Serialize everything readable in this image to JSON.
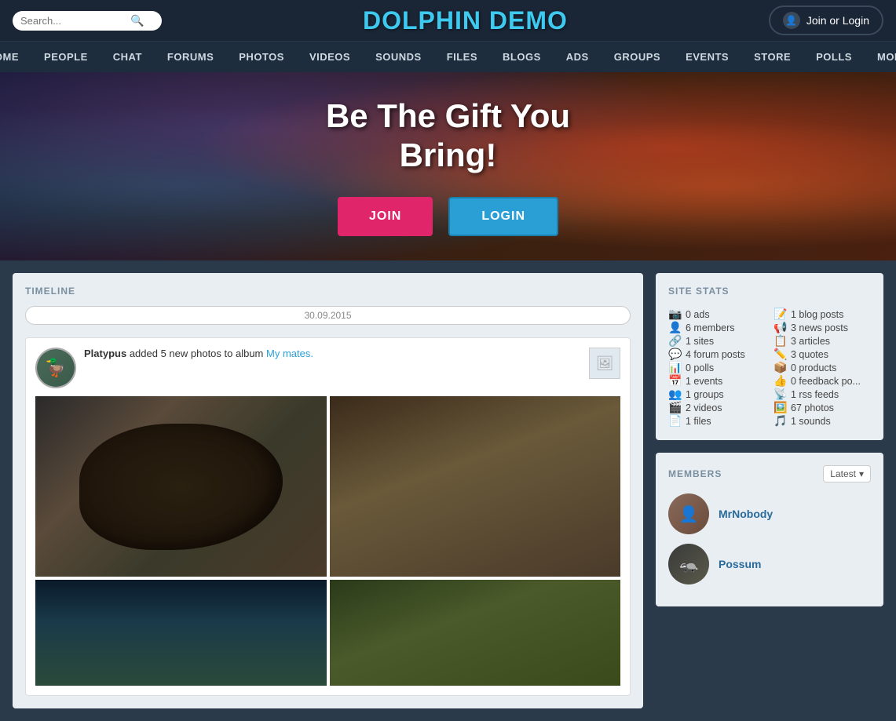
{
  "header": {
    "search_placeholder": "Search...",
    "site_title": "DOLPHIN DEMO",
    "login_button": "Join or Login"
  },
  "nav": {
    "items": [
      {
        "label": "HOME"
      },
      {
        "label": "PEOPLE"
      },
      {
        "label": "CHAT"
      },
      {
        "label": "FORUMS"
      },
      {
        "label": "PHOTOS"
      },
      {
        "label": "VIDEOS"
      },
      {
        "label": "SOUNDS"
      },
      {
        "label": "FILES"
      },
      {
        "label": "BLOGS"
      },
      {
        "label": "ADS"
      },
      {
        "label": "GROUPS"
      },
      {
        "label": "EVENTS"
      },
      {
        "label": "STORE"
      },
      {
        "label": "POLLS"
      },
      {
        "label": "MORE"
      }
    ]
  },
  "hero": {
    "title_line1": "Be The Gift You",
    "title_line2": "Bring!",
    "join_btn": "JOIN",
    "login_btn": "LOGIN"
  },
  "timeline": {
    "label": "TIMELINE",
    "date": "30.09.2015",
    "post": {
      "user": "Platypus",
      "action": " added 5 new photos to album ",
      "album": "My mates."
    }
  },
  "site_stats": {
    "label": "SITE STATS",
    "col1": [
      {
        "icon": "📷",
        "text": "0 ads"
      },
      {
        "icon": "👤",
        "text": "6 members"
      },
      {
        "icon": "🔗",
        "text": "1 sites"
      },
      {
        "icon": "💬",
        "text": "4 forum posts"
      },
      {
        "icon": "📊",
        "text": "0 polls"
      },
      {
        "icon": "📅",
        "text": "1 events"
      },
      {
        "icon": "👥",
        "text": "1 groups"
      },
      {
        "icon": "🎬",
        "text": "2 videos"
      },
      {
        "icon": "📄",
        "text": "1 files"
      }
    ],
    "col2": [
      {
        "icon": "📝",
        "text": "1 blog posts"
      },
      {
        "icon": "📢",
        "text": "3 news posts"
      },
      {
        "icon": "📋",
        "text": "3 articles"
      },
      {
        "icon": "✏️",
        "text": "3 quotes"
      },
      {
        "icon": "📦",
        "text": "0 products"
      },
      {
        "icon": "👍",
        "text": "0 feedback po..."
      },
      {
        "icon": "📡",
        "text": "1 rss feeds"
      },
      {
        "icon": "🖼️",
        "text": "67 photos"
      },
      {
        "icon": "🎵",
        "text": "1 sounds"
      }
    ]
  },
  "members": {
    "label": "MEMBERS",
    "filter": "Latest",
    "list": [
      {
        "name": "MrNobody",
        "avatar": "person"
      },
      {
        "name": "Possum",
        "avatar": "animal"
      }
    ]
  }
}
